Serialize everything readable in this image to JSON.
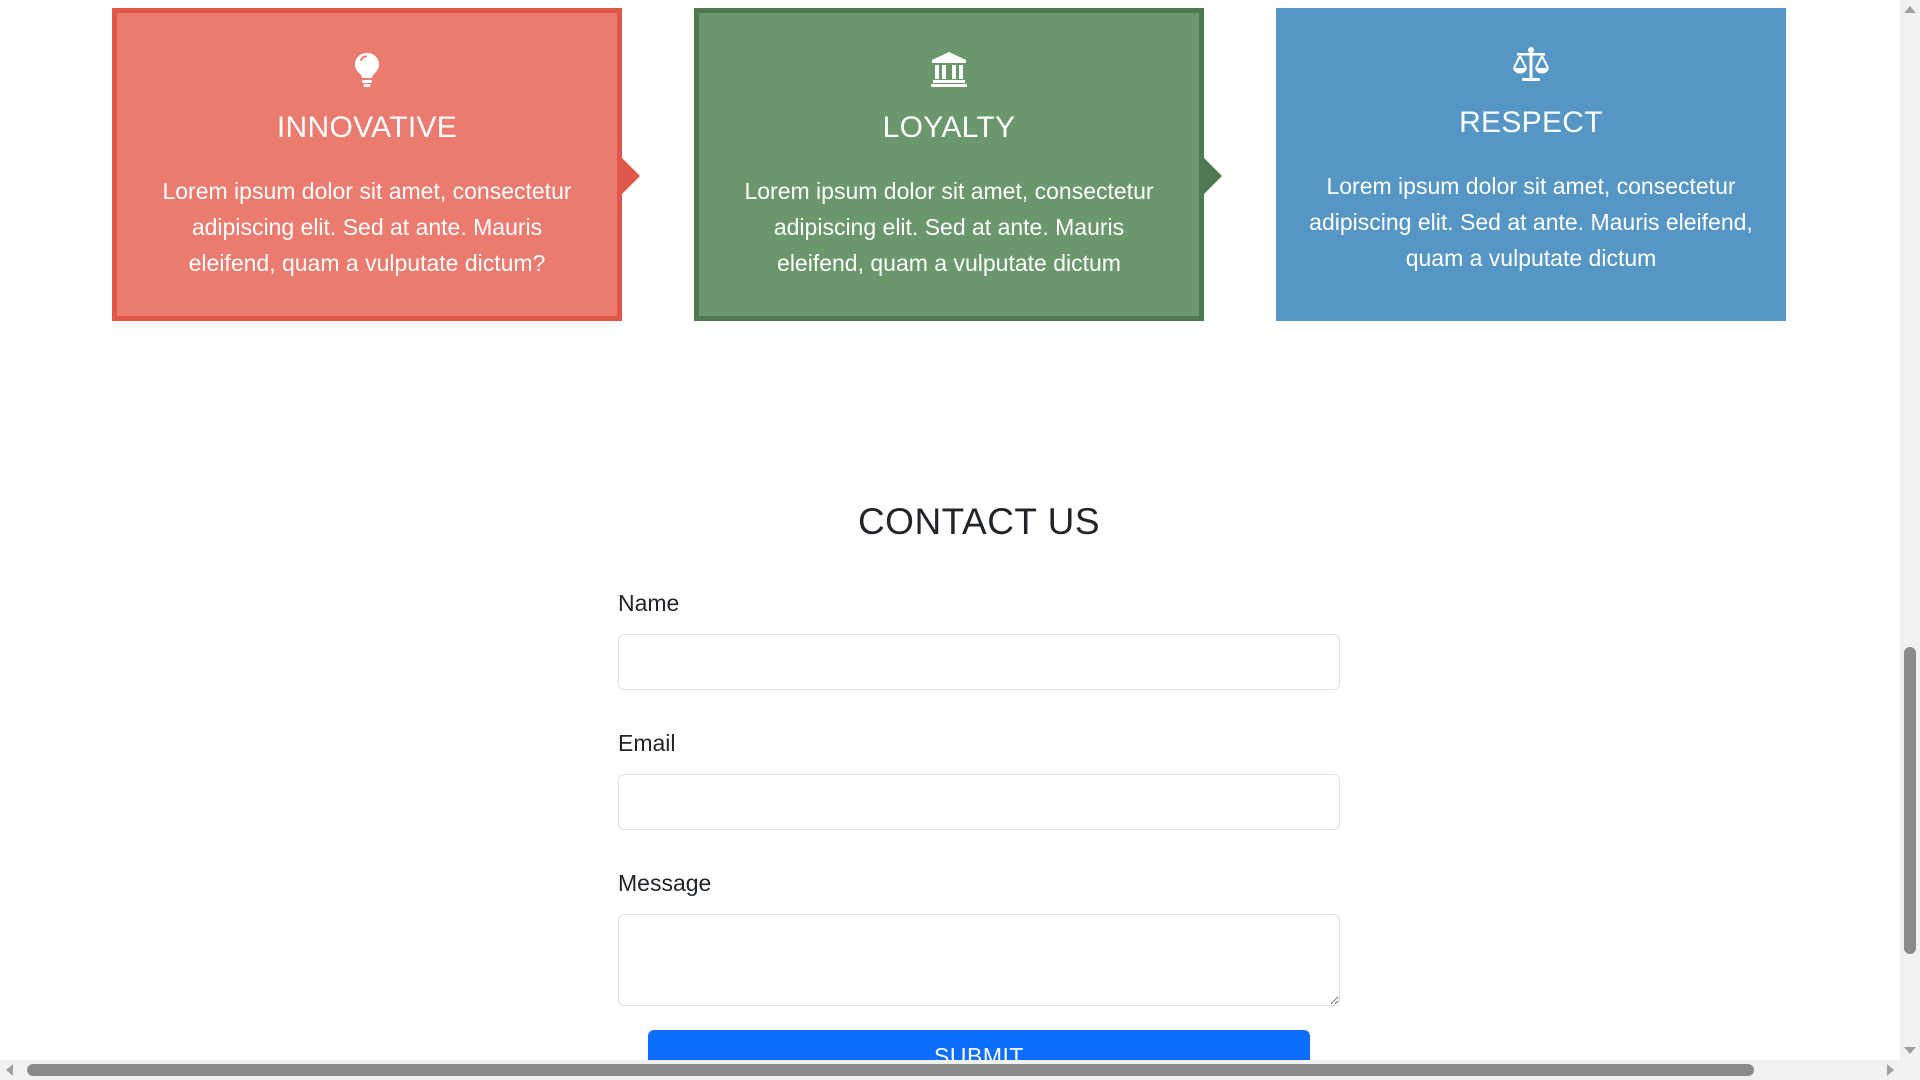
{
  "features": [
    {
      "icon": "lightbulb-icon",
      "title": "INNOVATIVE",
      "text": "Lorem ipsum dolor sit amet, consectetur adipiscing elit. Sed at ante. Mauris eleifend, quam a vulputate dictum?",
      "color": "#ec7b6f",
      "border_color": "#e0574a"
    },
    {
      "icon": "bank-icon",
      "title": "LOYALTY",
      "text": "Lorem ipsum dolor sit amet, consectetur adipiscing elit. Sed at ante. Mauris eleifend, quam a vulputate dictum",
      "color": "#6a976b",
      "border_color": "#4e7a50"
    },
    {
      "icon": "scales-icon",
      "title": "RESPECT",
      "text": "Lorem ipsum dolor sit amet, consectetur adipiscing elit. Sed at ante. Mauris eleifend, quam a vulputate dictum",
      "color": "#5596c5"
    }
  ],
  "contact": {
    "title": "CONTACT US",
    "name_label": "Name",
    "name_value": "",
    "email_label": "Email",
    "email_value": "",
    "message_label": "Message",
    "message_value": "",
    "submit_label": "SUBMIT",
    "submit_color": "#0d6efd"
  }
}
